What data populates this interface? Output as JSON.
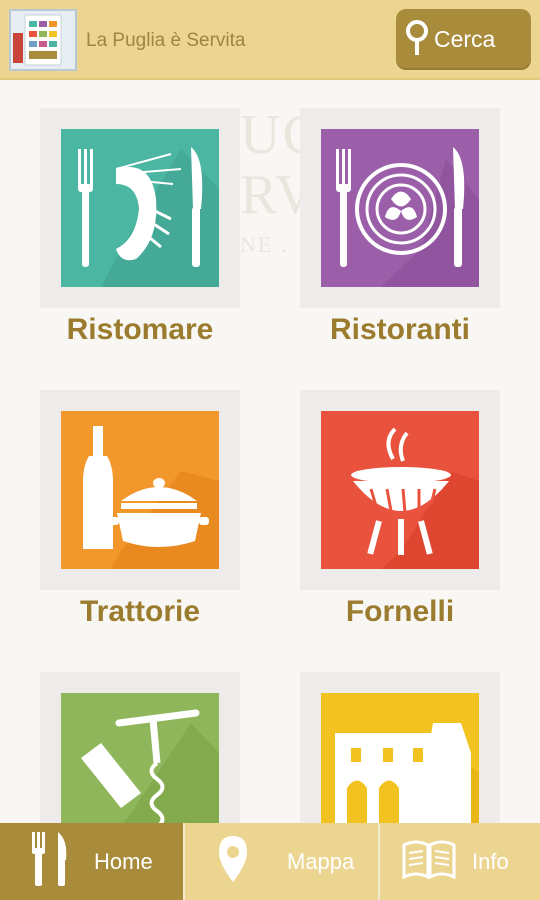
{
  "header": {
    "title": "La Puglia è Servita",
    "search_label": "Cerca",
    "logo_icon": "app-logo-icon",
    "search_icon": "map-pin-icon"
  },
  "watermark_lines": [
    "UC",
    "RV",
    "NE ."
  ],
  "tiles": [
    {
      "label": "Ristomare",
      "icon": "shrimp-cutlery-icon",
      "color": "#4bb7a3"
    },
    {
      "label": "Ristoranti",
      "icon": "pasta-plate-icon",
      "color": "#9a5fa8"
    },
    {
      "label": "Trattorie",
      "icon": "wine-pot-icon",
      "color": "#f2972c"
    },
    {
      "label": "Fornelli",
      "icon": "barbecue-grill-icon",
      "color": "#e9523c"
    },
    {
      "label": "",
      "icon": "corkscrew-icon",
      "color": "#8fb65a"
    },
    {
      "label": "",
      "icon": "castle-gate-icon",
      "color": "#f2c221"
    }
  ],
  "nav": {
    "home": "Home",
    "map": "Mappa",
    "info": "Info"
  },
  "colors": {
    "header_bg": "#ecd590",
    "accent": "#a98b3c",
    "label_text": "#9b7b2d"
  }
}
